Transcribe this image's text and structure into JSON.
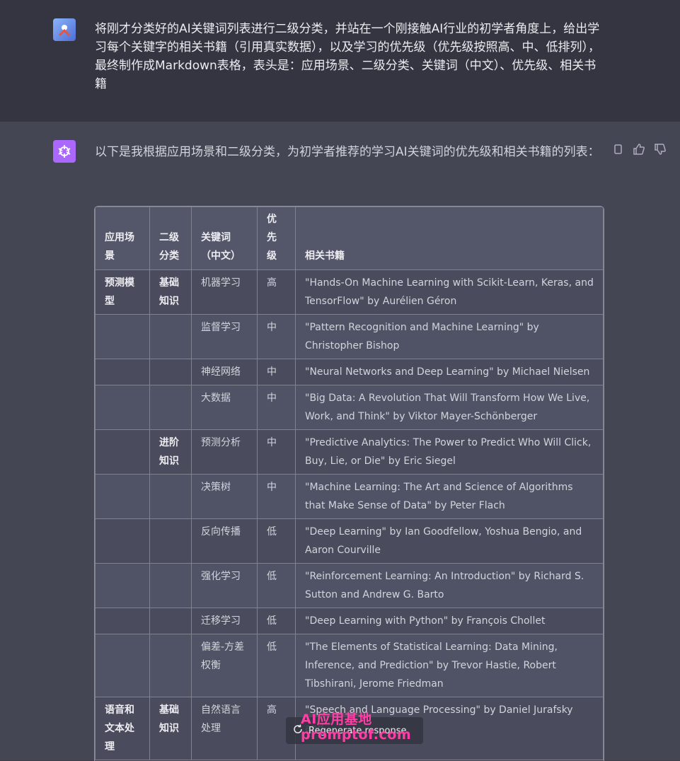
{
  "user": {
    "avatar_icon": "user-avatar-icon",
    "message": "将刚才分类好的AI关键词列表进行二级分类，并站在一个刚接触AI行业的初学者角度上，给出学习每个关键字的相关书籍（引用真实数据），以及学习的优先级（优先级按照高、中、低排列），最终制作成Markdown表格，表头是：应用场景、二级分类、关键词（中文）、优先级、相关书籍"
  },
  "assistant": {
    "avatar_icon": "openai-logo-icon",
    "intro": "以下是我根据应用场景和二级分类，为初学者推荐的学习AI关键词的优先级和相关书籍的列表：",
    "actions": [
      "copy-icon",
      "thumbs-up-icon",
      "thumbs-down-icon"
    ]
  },
  "table": {
    "headers": [
      "应用场景",
      "二级分类",
      "关键词（中文）",
      "优先级",
      "相关书籍"
    ],
    "rows": [
      [
        "预测模型",
        "基础知识",
        "机器学习",
        "高",
        "\"Hands-On Machine Learning with Scikit-Learn, Keras, and TensorFlow\" by Aurélien Géron"
      ],
      [
        "",
        "",
        "监督学习",
        "中",
        "\"Pattern Recognition and Machine Learning\" by Christopher Bishop"
      ],
      [
        "",
        "",
        "神经网络",
        "中",
        "\"Neural Networks and Deep Learning\" by Michael Nielsen"
      ],
      [
        "",
        "",
        "大数据",
        "中",
        "\"Big Data: A Revolution That Will Transform How We Live, Work, and Think\" by Viktor Mayer-Schönberger"
      ],
      [
        "",
        "进阶知识",
        "预测分析",
        "中",
        "\"Predictive Analytics: The Power to Predict Who Will Click, Buy, Lie, or Die\" by Eric Siegel"
      ],
      [
        "",
        "",
        "决策树",
        "中",
        "\"Machine Learning: The Art and Science of Algorithms that Make Sense of Data\" by Peter Flach"
      ],
      [
        "",
        "",
        "反向传播",
        "低",
        "\"Deep Learning\" by Ian Goodfellow, Yoshua Bengio, and Aaron Courville"
      ],
      [
        "",
        "",
        "强化学习",
        "低",
        "\"Reinforcement Learning: An Introduction\" by Richard S. Sutton and Andrew G. Barto"
      ],
      [
        "",
        "",
        "迁移学习",
        "低",
        "\"Deep Learning with Python\" by François Chollet"
      ],
      [
        "",
        "",
        "偏差-方差权衡",
        "低",
        "\"The Elements of Statistical Learning: Data Mining, Inference, and Prediction\" by Trevor Hastie, Robert Tibshirani, Jerome Friedman"
      ],
      [
        "语音和文本处理",
        "基础知识",
        "自然语言处理",
        "高",
        "\"Speech and Language Processing\" by Daniel Jurafsky and"
      ]
    ]
  },
  "regenerate": {
    "label": "Regenerate response",
    "icon": "refresh-icon"
  },
  "watermark": {
    "line1": "AI应用基地",
    "line2": "promptof.com"
  }
}
